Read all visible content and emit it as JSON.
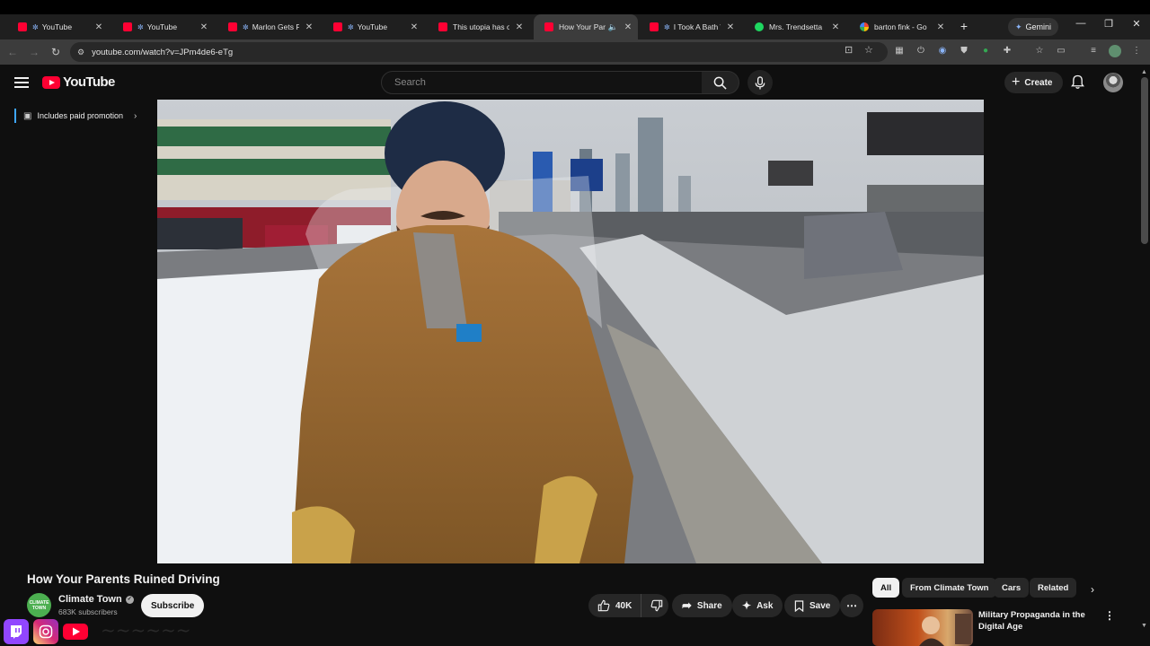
{
  "browser": {
    "tabs": [
      {
        "label": "YouTube",
        "favicon": "youtube-icon",
        "active": false
      },
      {
        "label": "YouTube",
        "favicon": "youtube-icon",
        "active": false
      },
      {
        "label": "Marlon Gets Fra",
        "favicon": "youtube-icon",
        "active": false
      },
      {
        "label": "YouTube",
        "favicon": "youtube-icon",
        "active": false
      },
      {
        "label": "This utopia has one",
        "favicon": "youtube-icon",
        "active": false
      },
      {
        "label": "How Your Paren",
        "favicon": "youtube-icon",
        "active": true
      },
      {
        "label": "I Took A Bath W",
        "favicon": "youtube-icon",
        "active": false
      },
      {
        "label": "Mrs. Trendsetta",
        "favicon": "spotify-icon",
        "active": false
      },
      {
        "label": "barton fink - Go",
        "favicon": "google-icon",
        "active": false
      }
    ],
    "gemini_label": "Gemini",
    "url": "youtube.com/watch?v=JPm4de6-eTg"
  },
  "youtube": {
    "logo_text": "YouTube",
    "search_placeholder": "Search",
    "create_label": "Create",
    "paid_promotion": "Includes paid promotion",
    "video": {
      "title": "How Your Parents Ruined Driving",
      "channel_name": "Climate Town",
      "channel_avatar_text": "CLIMATE TOWN",
      "subscribers": "683K subscribers",
      "subscribe_label": "Subscribe",
      "likes": "40K",
      "share_label": "Share",
      "ask_label": "Ask",
      "save_label": "Save"
    },
    "chips": [
      "All",
      "From Climate Town",
      "Cars",
      "Related"
    ],
    "recommendation": {
      "title": "Military Propaganda in the Digital Age"
    }
  },
  "colors": {
    "accent_red": "#ff0033",
    "background": "#0f0f0f",
    "promo_bar": "#3ea6ff"
  }
}
